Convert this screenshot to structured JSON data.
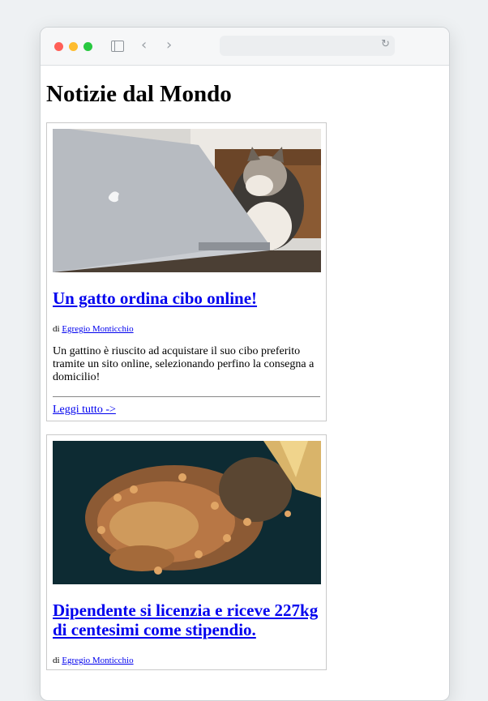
{
  "browser": {
    "back_icon": "chevron-left-icon",
    "forward_icon": "chevron-right-icon",
    "sidebar_icon": "sidebar-icon",
    "reload_icon": "reload-icon",
    "address": ""
  },
  "page": {
    "title": "Notizie dal Mondo"
  },
  "articles": [
    {
      "image_desc": "cat-with-laptop",
      "title": "Un gatto ordina cibo online!",
      "by_prefix": "di",
      "author": "Egregio Monticchio",
      "summary": "Un gattino è riuscito ad acquistare il suo cibo preferito tramite un sito online, selezionando perfino la consegna a domicilio!",
      "read_more": "Leggi tutto ->"
    },
    {
      "image_desc": "pile-of-coins",
      "title": "Dipendente si licenzia e riceve 227kg di centesimi come stipendio.",
      "by_prefix": "di",
      "author": "Egregio Monticchio"
    }
  ]
}
